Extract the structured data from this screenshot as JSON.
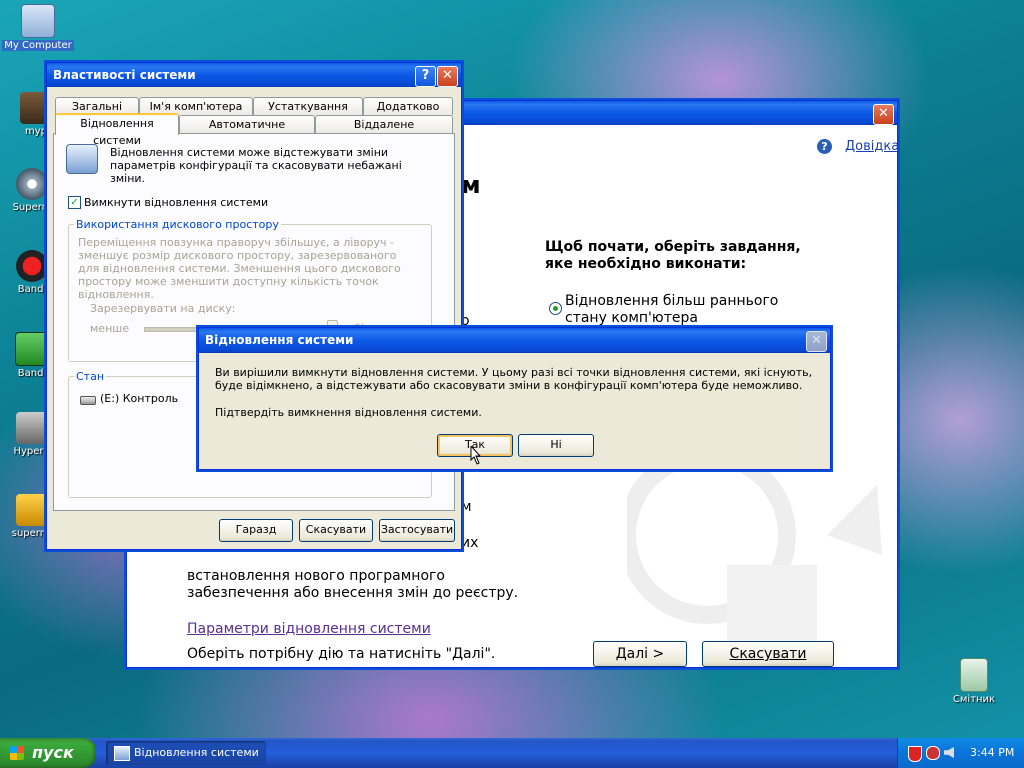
{
  "desktop": {
    "icons": [
      {
        "label": "My Computer"
      },
      {
        "label": "myp"
      },
      {
        "label": "Superm"
      },
      {
        "label": "Bandi"
      },
      {
        "label": "Bandi"
      },
      {
        "label": "HyperC"
      },
      {
        "label": "supermi"
      },
      {
        "label": "Смітник"
      }
    ]
  },
  "restore_window": {
    "help_link": "Довідка",
    "heading_fragment": "м",
    "prompt": "Щоб почати, оберіть завдання, яке необхідно виконати:",
    "option1": "Відновлення більш раннього стану комп'ютера",
    "left_fragments": [
      "о",
      "в",
      "м",
      "их"
    ],
    "desc_line1": "встановлення нового програмного",
    "desc_line2": "забезпечення або внесення змін до реєстру.",
    "settings_link": "Параметри відновлення системи",
    "instruction": "Оберіть потрібну дію та натисніть \"Далі\".",
    "next_button": "Далі >",
    "cancel_button": "Скасувати"
  },
  "properties_dialog": {
    "title": "Властивості системи",
    "tabs_row1": [
      "Загальні",
      "Ім'я комп'ютера",
      "Устаткування",
      "Додатково"
    ],
    "tabs_row2": [
      "Відновлення системи",
      "Автоматичне оновлення",
      "Віддалене використання"
    ],
    "intro": "Відновлення системи може відстежувати зміни параметрів конфігурації та скасовувати небажані зміни.",
    "disable_checkbox": "Вимкнути відновлення системи",
    "disk_group_title": "Використання дискового простору",
    "disk_desc": "Переміщення повзунка праворуч збільшує, а ліворуч - зменшує розмір дискового простору, зарезервованого для відновлення системи. Зменшення цього дискового простору може зменшити доступну кількість точок відновлення.",
    "reserve_label": "Зарезервувати на диску:",
    "less_label": "менше",
    "more_label": "більше",
    "status_group_title": "Стан",
    "drive_status": "(E:) Контроль",
    "ok_button": "Гаразд",
    "cancel_button": "Скасувати",
    "apply_button": "Застосувати"
  },
  "confirm_dialog": {
    "title": "Відновлення системи",
    "message": "Ви вирішили вимкнути відновлення системи. У цьому разі всі точки відновлення системи, які існують, буде відімкнено, а відстежувати або скасовувати зміни в конфігурації комп'ютера буде неможливо.",
    "confirm_text": "Підтвердіть вимкнення відновлення системи.",
    "yes_button": "Так",
    "no_button": "Ні"
  },
  "taskbar": {
    "start_label": "пуск",
    "task_label": "Відновлення системи",
    "clock": "3:44 PM"
  },
  "colors": {
    "xp_blue": "#0a5ae8",
    "start_green": "#3aa93a",
    "link_purple": "#5a2e8f"
  }
}
